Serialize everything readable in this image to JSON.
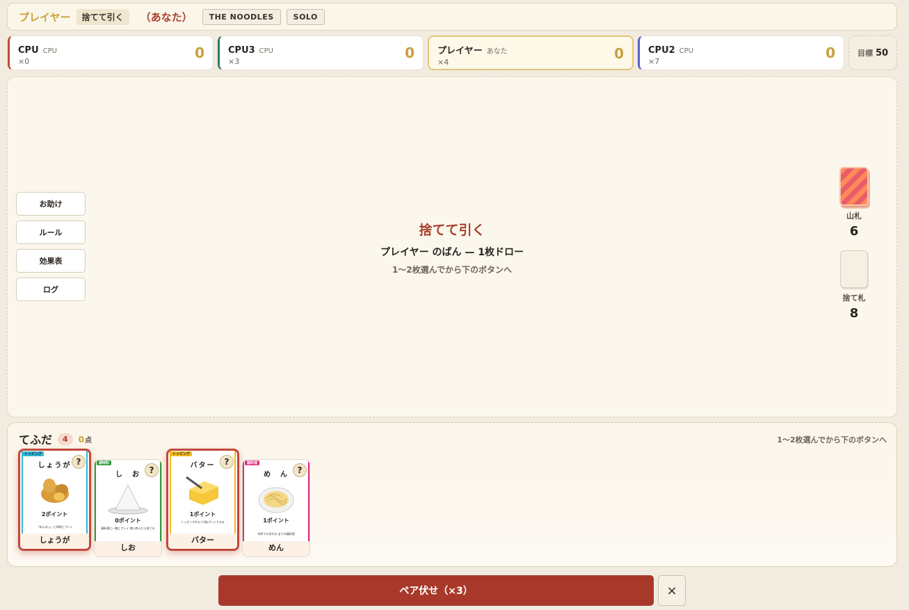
{
  "topbar": {
    "player": "プレイヤー",
    "phase": "捨てて引く",
    "you": "（あなた）",
    "tags": [
      "THE NOODLES",
      "SOLO"
    ]
  },
  "players": [
    {
      "name": "CPU",
      "sub": "CPU",
      "count": "×0",
      "score": "0",
      "color": "#c0483a"
    },
    {
      "name": "CPU3",
      "sub": "CPU",
      "count": "×3",
      "score": "0",
      "color": "#2e7d66"
    },
    {
      "name": "プレイヤー",
      "sub": "あなた",
      "count": "×4",
      "score": "0",
      "color": "#d9b95a"
    },
    {
      "name": "CPU2",
      "sub": "CPU",
      "count": "×7",
      "score": "0",
      "color": "#5663c6"
    }
  ],
  "goal": {
    "label": "目標",
    "value": "50"
  },
  "side_buttons": [
    "お助け",
    "ルール",
    "効果表",
    "ログ"
  ],
  "center": {
    "title": "捨てて引く",
    "turn": "プレイヤー のばん — 1枚ドロー",
    "hint": "1〜2枚選んでから下のボタンへ"
  },
  "deck": {
    "label": "山札",
    "count": "6"
  },
  "discard": {
    "label": "捨て札",
    "count": "8"
  },
  "hand": {
    "title": "てふだ",
    "count": "4",
    "points": "0",
    "points_unit": "点",
    "hint": "1〜2枚選んでから下のボタンへ",
    "cards": [
      {
        "name": "しょうが",
        "tag": "トッピング",
        "points": "2ポイント",
        "effect": "「めんぽっ」と同時にプレイ",
        "foot": "しょうが",
        "color": "#2fb6d8",
        "selected": true,
        "icon": "ginger-icon"
      },
      {
        "name": "し　お",
        "tag": "調味料",
        "points": "0ポイント",
        "effect": "麺料理に一緒にプレイ 使い終えたら捨てる",
        "foot": "しお",
        "color": "#2e9a3c",
        "selected": false,
        "icon": "salt-icon"
      },
      {
        "name": "バター",
        "tag": "トッピング",
        "points": "1ポイント",
        "effect": "トッピングをもう1枚プレイできる",
        "foot": "バター",
        "color": "#f2b91e",
        "selected": true,
        "icon": "butter-icon"
      },
      {
        "name": "め　ん",
        "tag": "麺料理",
        "points": "1ポイント",
        "effect": "何杯でも作れる 全ての麺料理",
        "foot": "めん",
        "color": "#e0277c",
        "selected": false,
        "icon": "noodles-icon"
      }
    ]
  },
  "actions": {
    "pair": "ペア伏せ（×3）",
    "close": "×"
  }
}
